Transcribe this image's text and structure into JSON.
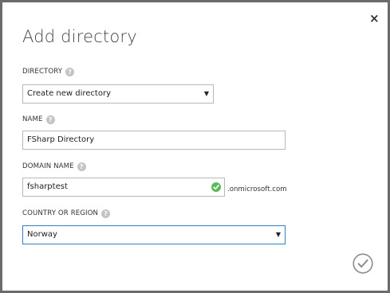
{
  "dialog": {
    "title": "Add directory",
    "close_glyph": "×",
    "confirm_icon": "checkmark-circle-icon"
  },
  "fields": {
    "directory": {
      "label": "DIRECTORY",
      "value": "Create new directory",
      "caret": "▼"
    },
    "name": {
      "label": "NAME",
      "value": "FSharp Directory"
    },
    "domain_name": {
      "label": "DOMAIN NAME",
      "value": "fsharptest",
      "suffix": ".onmicrosoft.com",
      "status_icon": "valid-check-icon"
    },
    "country": {
      "label": "COUNTRY OR REGION",
      "value": "Norway",
      "caret": "▼"
    }
  },
  "help_glyph": "?",
  "colors": {
    "overlay": "#6b6b6b",
    "focus_border": "#2f82c4",
    "valid_green": "#5cb85c",
    "help_gray": "#c4c4c4"
  }
}
